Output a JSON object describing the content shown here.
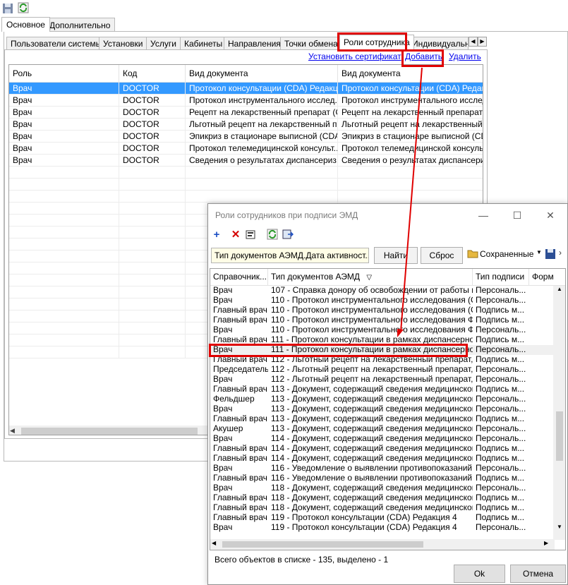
{
  "outer_tabs": [
    "Основное",
    "Дополнительно"
  ],
  "inner_tabs": [
    "Пользователи системы",
    "Установки",
    "Услуги",
    "Кабинеты",
    "Направления",
    "Точки обмена",
    "Роли сотрудника",
    "Индивидуальн"
  ],
  "links": {
    "set_cert": "Установить сертификат",
    "add": "Добавить",
    "delete": "Удалить"
  },
  "main_grid": {
    "headers": [
      "Роль",
      "Код",
      "Вид документа",
      "Вид документа"
    ],
    "rows": [
      [
        "Врач",
        "DOCTOR",
        "Протокол консультации (CDA) Редакц...",
        "Протокол консультации (CDA) Редакц..."
      ],
      [
        "Врач",
        "DOCTOR",
        "Протокол инструментального исслед...",
        "Протокол инструментального исследо..."
      ],
      [
        "Врач",
        "DOCTOR",
        "Рецепт на лекарственный препарат (С...",
        "Рецепт на лекарственный препарат (С..."
      ],
      [
        "Врач",
        "DOCTOR",
        "Льготный рецепт на лекарственный п...",
        "Льготный рецепт на лекарственный п..."
      ],
      [
        "Врач",
        "DOCTOR",
        "Эпикриз в стационаре выписной (CDA)",
        "Эпикриз в стационаре выписной (CDA)"
      ],
      [
        "Врач",
        "DOCTOR",
        "Протокол телемедицинской консульт...",
        "Протокол телемедицинской консульт..."
      ],
      [
        "Врач",
        "DOCTOR",
        "Сведения о результатах диспансериз...",
        "Сведения о результатах диспансериз..."
      ]
    ]
  },
  "dialog": {
    "title": "Роли сотрудников при подписи ЭМД",
    "filter_text": "Тип документов АЭМД.Дата активност...",
    "find": "Найти",
    "reset": "Сброс",
    "saved": "Сохраненные",
    "headers": [
      "Справочник...",
      "Тип документов АЭМД",
      "Тип подписи",
      "Форм"
    ],
    "rows": [
      [
        "Врач",
        "107 - Справка донору об освобождении от работы в ...",
        "Персональ..."
      ],
      [
        "Врач",
        "110 - Протокол инструментального исследования (С...",
        "Персональ..."
      ],
      [
        "Главный врач",
        "110 - Протокол инструментального исследования (С...",
        "Подпись м..."
      ],
      [
        "Главный врач",
        "110 - Протокол инструментального исследования Ф...",
        "Подпись м..."
      ],
      [
        "Врач",
        "110 - Протокол инструментального исследования Ф...",
        "Персональ..."
      ],
      [
        "Главный врач",
        "111 - Протокол консультации в рамках диспансерно...",
        "Подпись м..."
      ],
      [
        "Врач",
        "111 - Протокол консультации в рамках диспансерно...",
        "Персональ..."
      ],
      [
        "Главный врач",
        "112 - Льготный рецепт на лекарственный препарат, ...",
        "Подпись м..."
      ],
      [
        "Председатель",
        "112 - Льготный рецепт на лекарственный препарат, ...",
        "Персональ..."
      ],
      [
        "Врач",
        "112 - Льготный рецепт на лекарственный препарат, ...",
        "Персональ..."
      ],
      [
        "Главный врач",
        "113 - Документ, содержащий сведения медицинског...",
        "Подпись м..."
      ],
      [
        "Фельдшер",
        "113 - Документ, содержащий сведения медицинског...",
        "Персональ..."
      ],
      [
        "Врач",
        "113 - Документ, содержащий сведения медицинског...",
        "Персональ..."
      ],
      [
        "Главный врач",
        "113 - Документ, содержащий сведения медицинског...",
        "Подпись м..."
      ],
      [
        "Акушер",
        "113 - Документ, содержащий сведения медицинског...",
        "Персональ..."
      ],
      [
        "Врач",
        "114 - Документ, содержащий сведения медицинског...",
        "Персональ..."
      ],
      [
        "Главный врач",
        "114 - Документ, содержащий сведения медицинског...",
        "Подпись м..."
      ],
      [
        "Главный врач",
        "114 - Документ, содержащий сведения медицинског...",
        "Подпись м..."
      ],
      [
        "Врач",
        "116 - Уведомление о выявлении противопоказаний ...",
        "Персональ..."
      ],
      [
        "Главный врач",
        "116 - Уведомление о выявлении противопоказаний ...",
        "Подпись м..."
      ],
      [
        "Врач",
        "118 - Документ, содержащий сведения медицинског...",
        "Персональ..."
      ],
      [
        "Главный врач",
        "118 - Документ, содержащий сведения медицинског...",
        "Подпись м..."
      ],
      [
        "Главный врач",
        "118 - Документ, содержащий сведения медицинског...",
        "Подпись м..."
      ],
      [
        "Главный врач",
        "119 - Протокол консультации (CDA) Редакция 4",
        "Подпись м..."
      ],
      [
        "Врач",
        "119 - Протокол консультации (CDA) Редакция 4",
        "Персональ..."
      ]
    ],
    "status": "Всего объектов в списке - 135, выделено - 1",
    "ok": "Ok",
    "cancel": "Отмена"
  },
  "colors": {
    "selection": "#3399ff",
    "annotation": "#e00000",
    "filter_bg": "#fffde6"
  }
}
